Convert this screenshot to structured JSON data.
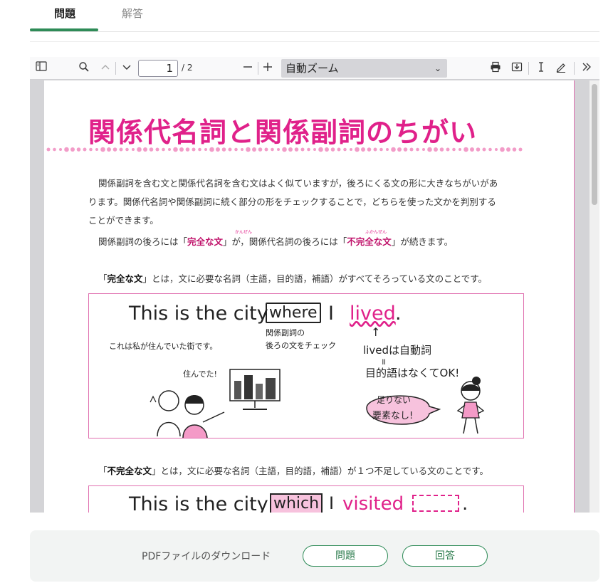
{
  "tabs": [
    {
      "label": "問題",
      "active": true
    },
    {
      "label": "解答",
      "active": false
    }
  ],
  "accent_color": "#2e8b57",
  "pdf_toolbar": {
    "page_current": "1",
    "page_total": "/ 2",
    "zoom": "自動ズーム",
    "icons": [
      "sidebar-toggle-icon",
      "search-icon",
      "chevron-up-icon",
      "chevron-down-icon",
      "zoom-out-icon",
      "zoom-in-icon",
      "print-icon",
      "save-icon",
      "text-cursor-icon",
      "pen-icon",
      "double-chevron-right-icon"
    ]
  },
  "document": {
    "title": "関係代名詞と関係副詞のちがい",
    "title_color": "#e0218a",
    "para1_line1": "関係副詞を含む文と関係代名詞を含む文はよく似ていますが，後ろにくる文の形に大きなちがいがあ",
    "para1_line2": "ります。関係代名詞や関係副詞に続く部分の形をチェックすることで，どちらを使った文かを判別する",
    "para1_line3": "ことができます。",
    "para2_pre": "関係副詞の後ろには「",
    "para2_term1": "完全な文",
    "para2_ruby1": "かんぜん",
    "para2_mid": "」が，関係代名詞の後ろには「",
    "para2_term2": "不完全な文",
    "para2_ruby2": "ふかんぜん",
    "para2_post": "」が続きます。",
    "def1_open": "「",
    "def1_term": "完全な文",
    "def1_rest": "」とは，文に必要な名詞（主語，目的語，補語）がすべてそろっている文のことです。",
    "def2_open": "「",
    "def2_term": "不完全な文",
    "def2_rest": "」とは，文に必要な名詞（主語，目的語，補語）が１つ不足している文のことです。",
    "illus1": {
      "s1": "This is the city",
      "s2": "where",
      "s3": "I",
      "s4": "lived",
      "s5": ".",
      "translation": "これは私が住んでいた街です。",
      "note1": "関係副詞の",
      "note2": "後ろの文をチェック",
      "note3": "livedは自動詞",
      "note4": "目的語はなくてOK!",
      "bubble1": "足りない",
      "bubble2": "要素なし!",
      "speech": "住んでた!"
    },
    "illus2": {
      "s1": "This is the city",
      "s2": "which",
      "s3": "I",
      "s4": "visited",
      "s5": "."
    }
  },
  "footer": {
    "label": "PDFファイルのダウンロード",
    "btn_question": "問題",
    "btn_answer": "回答"
  }
}
